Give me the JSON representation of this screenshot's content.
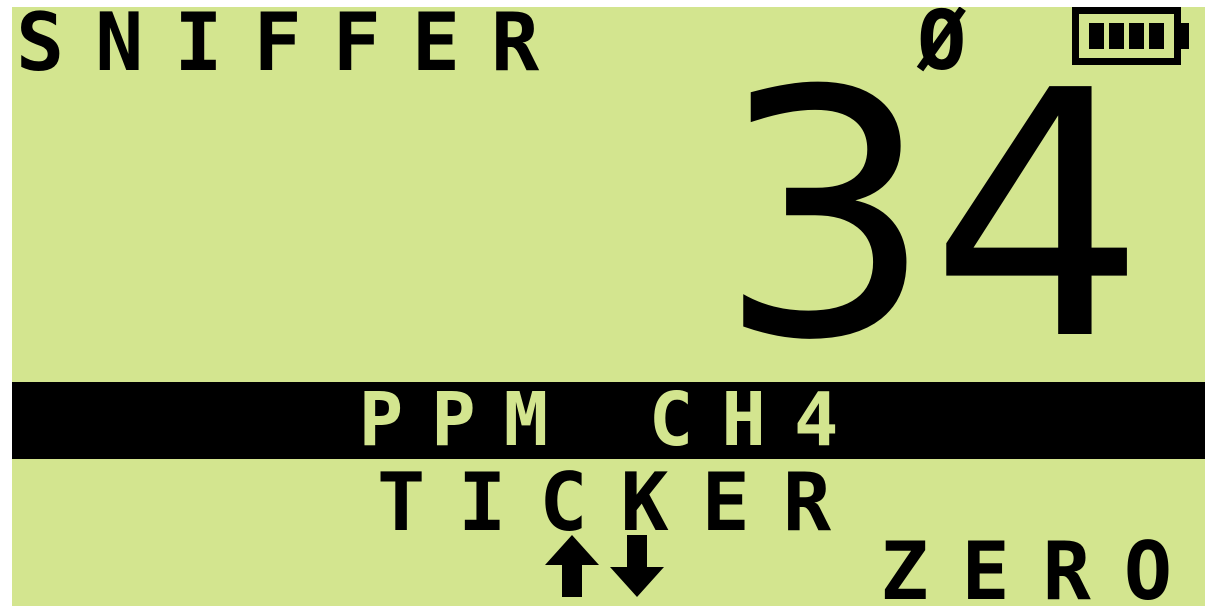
{
  "display": {
    "mode_label": "SNIFFER",
    "null_indicator": "Ø",
    "battery_icon": "battery-full-icon",
    "battery_level": 1.0,
    "reading": "34",
    "unit": "PPM CH4",
    "sub_mode": "TICKER",
    "arrow_keys_icon": "up-down-arrows-icon",
    "zero_label": "ZERO",
    "background_color": "#d3e58f",
    "text_color": "#000000"
  }
}
